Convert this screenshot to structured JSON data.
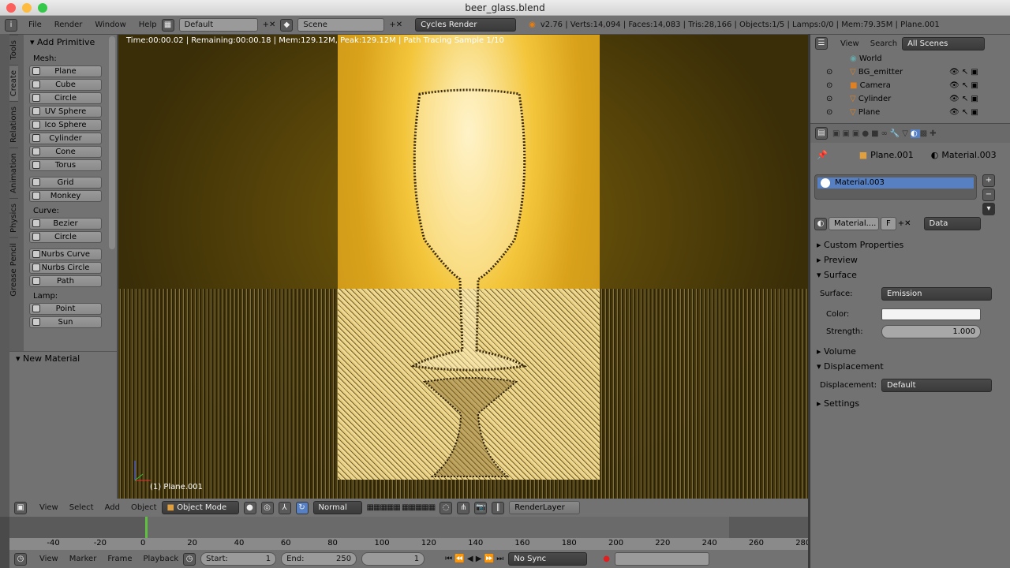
{
  "window": {
    "title": "beer_glass.blend"
  },
  "info_header": {
    "menus": [
      "File",
      "Render",
      "Window",
      "Help"
    ],
    "screen": "Default",
    "scene": "Scene",
    "engine": "Cycles Render",
    "stats": "v2.76 | Verts:14,094 | Faces:14,083 | Tris:28,166 | Objects:1/5 | Lamps:0/0 | Mem:79.35M | Plane.001"
  },
  "toolshelf": {
    "tabs": [
      "Tools",
      "Create",
      "Relations",
      "Animation",
      "Physics",
      "Grease Pencil"
    ],
    "panel": "Add Primitive",
    "mesh_label": "Mesh:",
    "mesh": [
      "Plane",
      "Cube",
      "Circle",
      "UV Sphere",
      "Ico Sphere",
      "Cylinder",
      "Cone",
      "Torus"
    ],
    "mesh2": [
      "Grid",
      "Monkey"
    ],
    "curve_label": "Curve:",
    "curve": [
      "Bezier",
      "Circle"
    ],
    "surface": [
      "Nurbs Curve",
      "Nurbs Circle",
      "Path"
    ],
    "lamp_label": "Lamp:",
    "lamp": [
      "Point",
      "Sun"
    ],
    "operator_panel": "New Material"
  },
  "viewport": {
    "render_status": "Time:00:00.02 | Remaining:00:00.18 | Mem:129.12M, Peak:129.12M | Path Tracing Sample 1/10",
    "object_label": "(1) Plane.001"
  },
  "view3d_header": {
    "menus": [
      "View",
      "Select",
      "Add",
      "Object"
    ],
    "mode": "Object Mode",
    "orientation": "Normal",
    "render_layer": "RenderLayer"
  },
  "timeline": {
    "ticks": [
      "-40",
      "-20",
      "0",
      "20",
      "40",
      "60",
      "80",
      "100",
      "120",
      "140",
      "160",
      "180",
      "200",
      "220",
      "240",
      "260",
      "280"
    ],
    "current_frame": 0,
    "menus": [
      "View",
      "Marker",
      "Frame",
      "Playback"
    ],
    "start_label": "Start:",
    "start": "1",
    "end_label": "End:",
    "end": "250",
    "frame": "1",
    "sync": "No Sync"
  },
  "outliner": {
    "menus": [
      "View",
      "Search"
    ],
    "filter": "All Scenes",
    "items": [
      "World",
      "BG_emitter",
      "Camera",
      "Cylinder",
      "Plane"
    ]
  },
  "properties": {
    "object": "Plane.001",
    "material": "Material.003",
    "slot": "Material.003",
    "material_field": "Material....",
    "f_label": "F",
    "link": "Data",
    "panels": {
      "custom": "Custom Properties",
      "preview": "Preview",
      "surface": "Surface",
      "volume": "Volume",
      "displacement": "Displacement",
      "settings": "Settings"
    },
    "surface_label": "Surface:",
    "surface_value": "Emission",
    "color_label": "Color:",
    "color_value": "#f4f4f4",
    "strength_label": "Strength:",
    "strength_value": "1.000",
    "displacement_label": "Displacement:",
    "displacement_value": "Default"
  }
}
